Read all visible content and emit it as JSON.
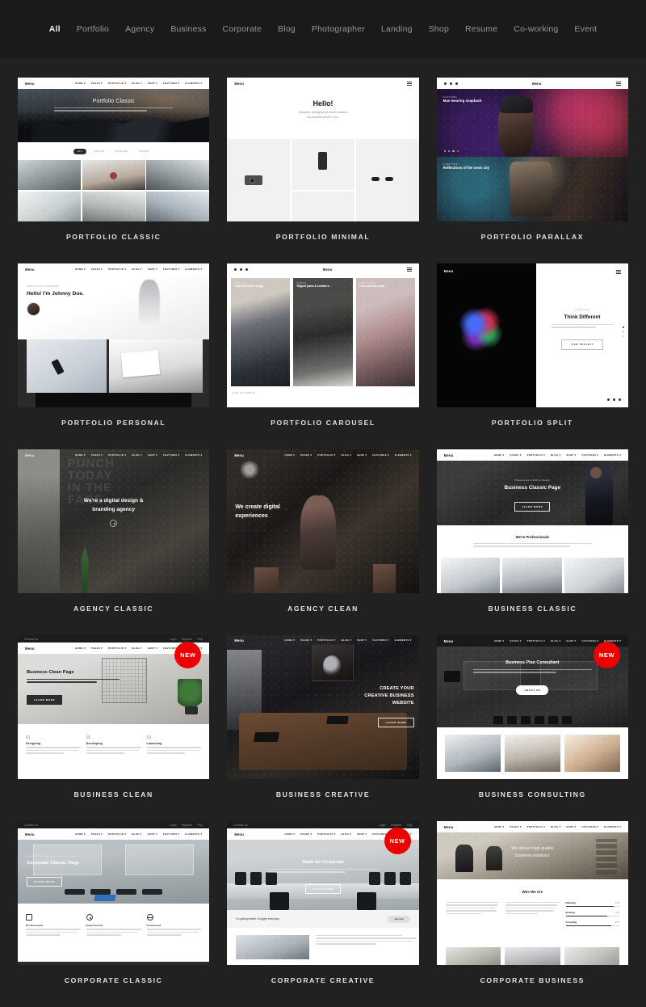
{
  "filter": {
    "items": [
      {
        "label": "All",
        "active": true
      },
      {
        "label": "Portfolio",
        "active": false
      },
      {
        "label": "Agency",
        "active": false
      },
      {
        "label": "Business",
        "active": false
      },
      {
        "label": "Corporate",
        "active": false
      },
      {
        "label": "Blog",
        "active": false
      },
      {
        "label": "Photographer",
        "active": false
      },
      {
        "label": "Landing",
        "active": false
      },
      {
        "label": "Shop",
        "active": false
      },
      {
        "label": "Resume",
        "active": false
      },
      {
        "label": "Co-working",
        "active": false
      },
      {
        "label": "Event",
        "active": false
      }
    ]
  },
  "colors": {
    "page_background": "#212121",
    "filter_background": "#1a1a1a",
    "badge_red": "#ee0000",
    "caption_text": "#e7e2dd",
    "filter_text": "#9b9691",
    "filter_text_active": "#efebe7"
  },
  "common": {
    "logo": "Menu",
    "menu_items": [
      "HOME",
      "PAGES",
      "PORTFOLIO",
      "BLOG",
      "SHOP",
      "FEATURES",
      "ELEMENTS"
    ],
    "topbar_left": "Contact us",
    "topbar_right": [
      "Login",
      "Register",
      "FAQ"
    ],
    "badge_new": "NEW"
  },
  "cards": [
    {
      "id": "portfolio-classic",
      "caption": "PORTFOLIO CLASSIC",
      "badge": null,
      "hero_title": "Portfolio Classic",
      "hero_sub": "Lorem ipsum dolor sit amet, consectetur adipiscing elit, sed do eiusmod tempor incididunt",
      "filter_tabs": [
        "ALL",
        "NATURE",
        "WILDLIFE",
        "WINTER"
      ]
    },
    {
      "id": "portfolio-minimal",
      "caption": "PORTFOLIO MINIMAL",
      "badge": null,
      "hero_title": "Hello!",
      "hero_sub": "Designers, photographers and all creatives this template is built for you.",
      "products": [
        "camera",
        "phone",
        "sunglasses"
      ]
    },
    {
      "id": "portfolio-parallax",
      "caption": "PORTFOLIO PARALLAX",
      "badge": null,
      "slides": [
        {
          "category": "Clothing",
          "title": "Man wearing snapback"
        },
        {
          "category": "Lifestyle",
          "title": "Reflections of the neon city"
        }
      ]
    },
    {
      "id": "portfolio-personal",
      "caption": "PORTFOLIO PERSONAL",
      "badge": null,
      "eyebrow": "PORTFOLIO PERSONAL",
      "hero_title": "Hello! I'm Johnny Doe."
    },
    {
      "id": "portfolio-carousel",
      "caption": "PORTFOLIO CAROUSEL",
      "badge": null,
      "slides": [
        {
          "category": "Outdoor",
          "title": "Coat with jeans & bag"
        },
        {
          "category": "Casual",
          "title": "Ripped jeans & sneakers"
        },
        {
          "category": "Streetwear",
          "title": "Pink coat with scarf"
        }
      ],
      "footer_link": "VIEW ALL WORKS",
      "pager": [
        "‹",
        "›"
      ]
    },
    {
      "id": "portfolio-split",
      "caption": "PORTFOLIO SPLIT",
      "badge": null,
      "eyebrow": "CATEGORY",
      "hero_title": "Think Different",
      "hero_sub": "Lorem ipsum dolor sit amet, consectetur adipiscing elit, tempor commodo ligula eget dolor. Aenean massa.",
      "button": "VIEW PROJECT"
    },
    {
      "id": "agency-classic",
      "caption": "AGENCY CLASSIC",
      "badge": null,
      "wall_text": [
        "PUNCH",
        "TODAY",
        "IN THE",
        "FACE."
      ],
      "hero_title": "We're a digital design & branding agency"
    },
    {
      "id": "agency-clean",
      "caption": "AGENCY CLEAN",
      "badge": null,
      "hero_title": "We create digital experiences"
    },
    {
      "id": "business-classic",
      "caption": "BUSINESS CLASSIC",
      "badge": null,
      "eyebrow": "Responsive & Retina Ready",
      "hero_title": "Business Classic Page",
      "button": "LEARN MORE",
      "section_title": "We're Professionals",
      "section_sub": "Lorem ipsum dolor sit amet, consectetur adipiscing elit. Aenean massa. Cum sociis natoque penatibus et magnis dis parturient montes, nascetur ridiculus mus."
    },
    {
      "id": "business-clean",
      "caption": "BUSINESS CLEAN",
      "badge": "NEW",
      "hero_title": "Business Clean Page",
      "hero_sub": "Quisque rutrum. Aenean imperdiet. Etiam ultricies nisi vel augue. Curabitur ullamcorper ultricies nisi.",
      "button": "LEARN MORE",
      "steps": [
        {
          "num": "01",
          "title": "Designing",
          "text": "Lorem ipsum dolor sit amet, consectetuer adipiscing elit. Aenean commodo ligula eget dolor. Aenean massa."
        },
        {
          "num": "02",
          "title": "Developing",
          "text": "Lorem ipsum dolor sit amet, consectetuer adipiscing elit. Aenean commodo ligula eget dolor. Aenean massa."
        },
        {
          "num": "03",
          "title": "Launching",
          "text": "Lorem ipsum dolor sit amet, consectetuer adipiscing elit. Aenean commodo ligula eget dolor. Aenean massa."
        }
      ]
    },
    {
      "id": "business-creative",
      "caption": "BUSINESS CREATIVE",
      "badge": null,
      "hero_title": "CREATE YOUR CREATIVE BUSINESS WEBSITE",
      "button": "LEARN MORE"
    },
    {
      "id": "business-consulting",
      "caption": "BUSINESS CONSULTING",
      "badge": "NEW",
      "hero_title": "Business Plan Consultant",
      "hero_sub": "Quisque rutrum. Aenean imperdiet. Etiam ultricies nisi vel augue. Curabitur ullamcorper ultricies nisi. Nam eget dui.",
      "button": "ABOUT US"
    },
    {
      "id": "corporate-classic",
      "caption": "CORPORATE CLASSIC",
      "badge": null,
      "eyebrow": "AWESOME & CLEAN BUSINESS TEMPLATE",
      "hero_title": "Corporate Classic Page",
      "button": "LEARN MORE",
      "features": [
        {
          "icon": "briefcase-icon",
          "title": "Professional",
          "text": "Lorem ipsum dolor sit amet, consectetuer adipiscing elit. Aenean commodo ligula eget dolor. Aenean massa."
        },
        {
          "icon": "gear-icon",
          "title": "Experienced",
          "text": "Lorem ipsum dolor sit amet, consectetuer adipiscing elit. Aenean commodo ligula eget dolor. Aenean massa."
        },
        {
          "icon": "globe-icon",
          "title": "Connected",
          "text": "Lorem ipsum dolor sit amet, consectetuer adipiscing elit. Aenean commodo ligula eget dolor. Aenean massa."
        }
      ]
    },
    {
      "id": "corporate-creative",
      "caption": "CORPORATE CREATIVE",
      "badge": "NEW",
      "hero_title": "Made for Corporate",
      "hero_sub": "Placerat viverra nulla ut metus varius laoreet. Quisque rutrum dolor aenean imperdiet.",
      "button": "LEARN MORE",
      "cta_text": "It's getting better & bigger everyday",
      "cta_button": "Join now"
    },
    {
      "id": "corporate-business",
      "caption": "CORPORATE BUSINESS",
      "badge": null,
      "hero_title": "We deliver high quality business solutions",
      "section_title": "Who We Are",
      "skills": [
        {
          "label": "Marketing",
          "value": "90%"
        },
        {
          "label": "Branding",
          "value": "78%"
        },
        {
          "label": "Consulting",
          "value": "85%"
        }
      ]
    }
  ]
}
